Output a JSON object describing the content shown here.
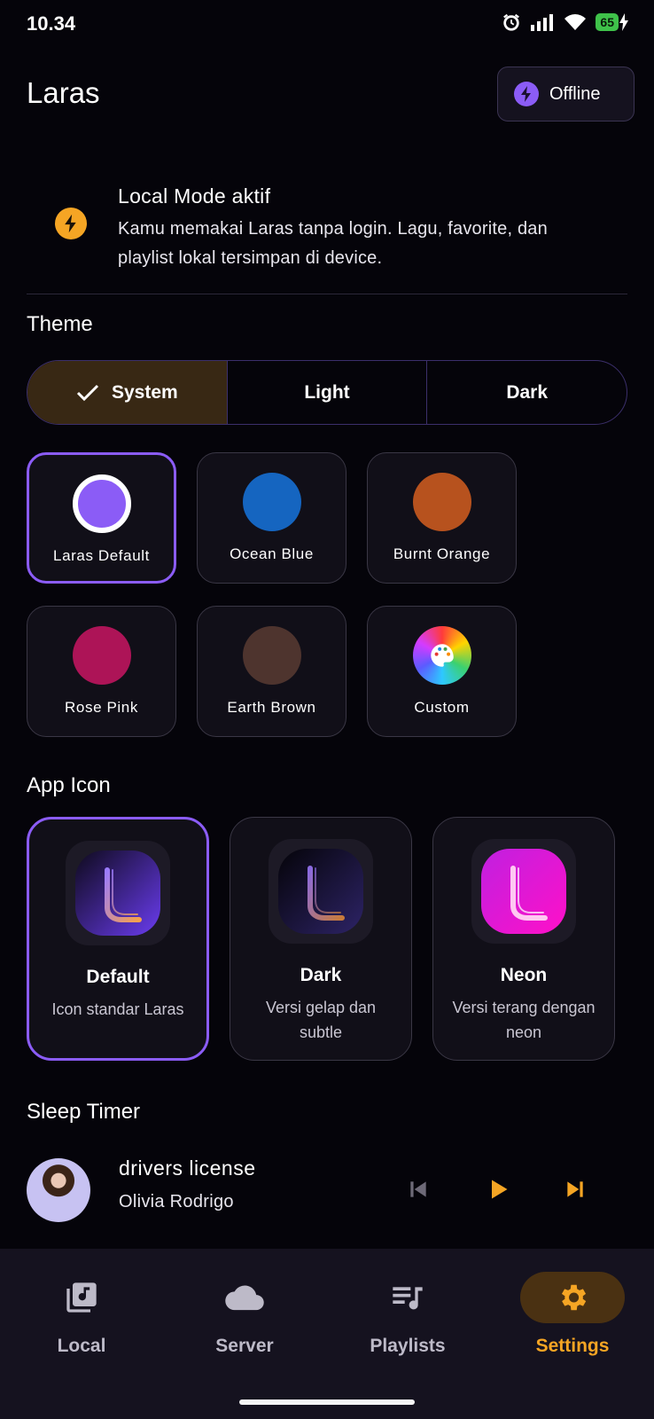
{
  "status_bar": {
    "time": "10.34",
    "battery": "65"
  },
  "header": {
    "title": "Laras",
    "offline_label": "Offline"
  },
  "local_mode": {
    "title": "Local Mode aktif",
    "description": "Kamu memakai Laras tanpa login. Lagu, favorite, dan playlist lokal tersimpan di device."
  },
  "theme": {
    "section_title": "Theme",
    "modes": [
      {
        "label": "System",
        "selected": true
      },
      {
        "label": "Light",
        "selected": false
      },
      {
        "label": "Dark",
        "selected": false
      }
    ],
    "colors": [
      {
        "name": "Laras Default",
        "color": "#8b5cf6",
        "selected": true
      },
      {
        "name": "Ocean Blue",
        "color": "#1565c0",
        "selected": false
      },
      {
        "name": "Burnt Orange",
        "color": "#b7521e",
        "selected": false
      },
      {
        "name": "Rose Pink",
        "color": "#ad1457",
        "selected": false
      },
      {
        "name": "Earth Brown",
        "color": "#4e342e",
        "selected": false
      },
      {
        "name": "Custom",
        "icon": "palette-icon",
        "selected": false
      }
    ]
  },
  "app_icon": {
    "section_title": "App Icon",
    "options": [
      {
        "title": "Default",
        "description": "Icon standar Laras",
        "selected": true
      },
      {
        "title": "Dark",
        "description": "Versi gelap dan subtle",
        "selected": false
      },
      {
        "title": "Neon",
        "description": "Versi terang dengan neon",
        "selected": false
      }
    ]
  },
  "sleep_timer": {
    "section_title": "Sleep Timer"
  },
  "player": {
    "title": "drivers license",
    "artist": "Olivia Rodrigo"
  },
  "nav": {
    "items": [
      {
        "label": "Local",
        "icon": "library-music-icon",
        "active": false
      },
      {
        "label": "Server",
        "icon": "cloud-icon",
        "active": false
      },
      {
        "label": "Playlists",
        "icon": "queue-music-icon",
        "active": false
      },
      {
        "label": "Settings",
        "icon": "gear-icon",
        "active": true
      }
    ]
  },
  "colors": {
    "accent": "#f5a524",
    "primary": "#8b5cf6",
    "background": "#05040a"
  }
}
